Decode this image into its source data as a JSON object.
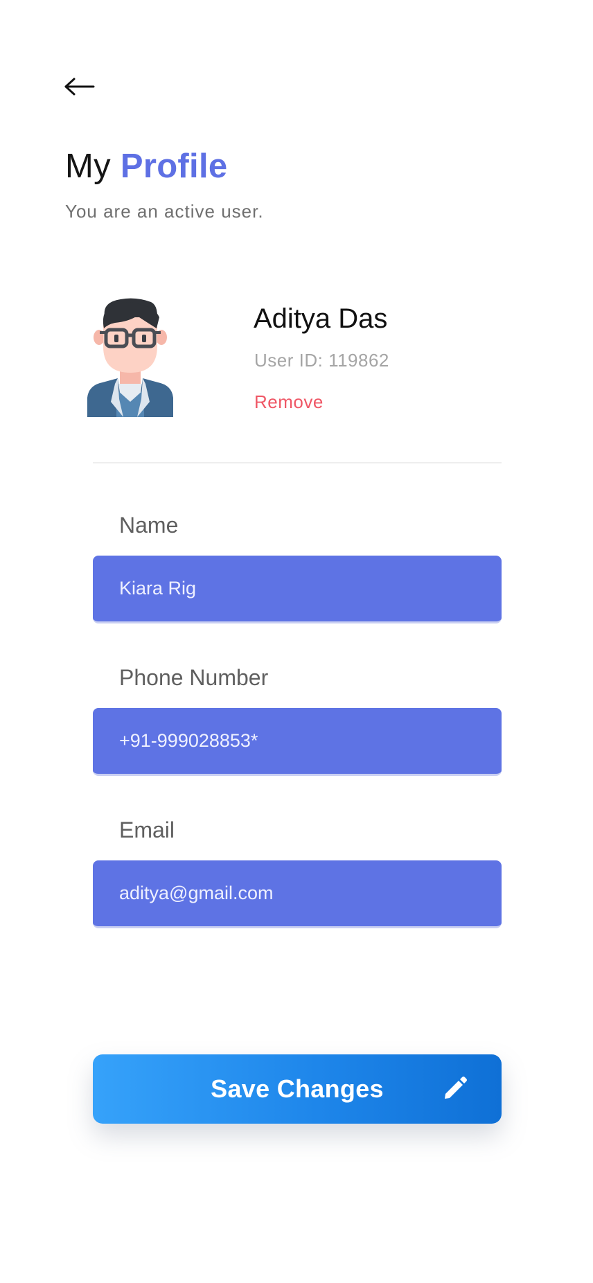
{
  "header": {
    "back_icon": "arrow-left-icon",
    "title_prefix": "My ",
    "title_accent": "Profile",
    "subtitle": "You are an active user."
  },
  "profile": {
    "avatar_icon": "user-avatar-glasses",
    "name": "Aditya Das",
    "user_id": "User ID: 119862",
    "remove_label": "Remove"
  },
  "form": {
    "name": {
      "label": "Name",
      "value": "Kiara Rig"
    },
    "phone": {
      "label": "Phone Number",
      "value": "+91-999028853*"
    },
    "email": {
      "label": "Email",
      "value": "aditya@gmail.com"
    }
  },
  "actions": {
    "save_label": "Save Changes",
    "save_icon": "pencil-icon"
  },
  "colors": {
    "accent": "#5e70e4",
    "input_background": "#5e73e4",
    "danger": "#ef5766",
    "button_gradient_start": "#36a2fa",
    "button_gradient_end": "#0f70d6"
  }
}
